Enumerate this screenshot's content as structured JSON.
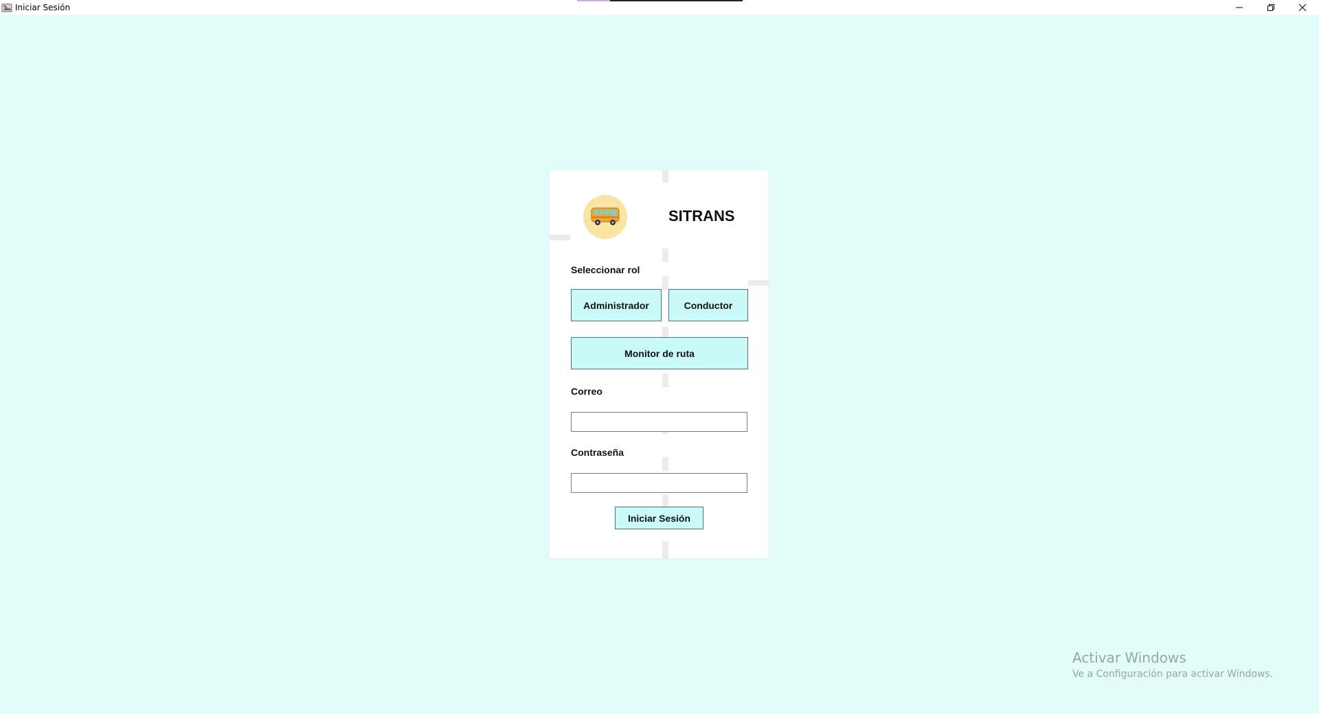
{
  "window": {
    "title": "Iniciar Sesión",
    "controls": [
      "minimize",
      "restore",
      "close"
    ]
  },
  "app": {
    "brand": "SITRANS",
    "logo_icon": "school-bus-icon"
  },
  "roles": {
    "label": "Seleccionar rol",
    "options": [
      "Administrador",
      "Conductor",
      "Monitor de ruta"
    ]
  },
  "form": {
    "email_label": "Correo",
    "email_value": "",
    "password_label": "Contraseña",
    "password_value": "",
    "submit_label": "Iniciar Sesión"
  },
  "watermark": {
    "title": "Activar Windows",
    "subtitle": "Ve a Configuración para activar Windows."
  },
  "colors": {
    "background": "#e0fdf9",
    "card": "#ffffff",
    "button_fill": "#c9faf8",
    "button_border": "#4a6f86",
    "logo_circle": "#f9e4a3"
  }
}
